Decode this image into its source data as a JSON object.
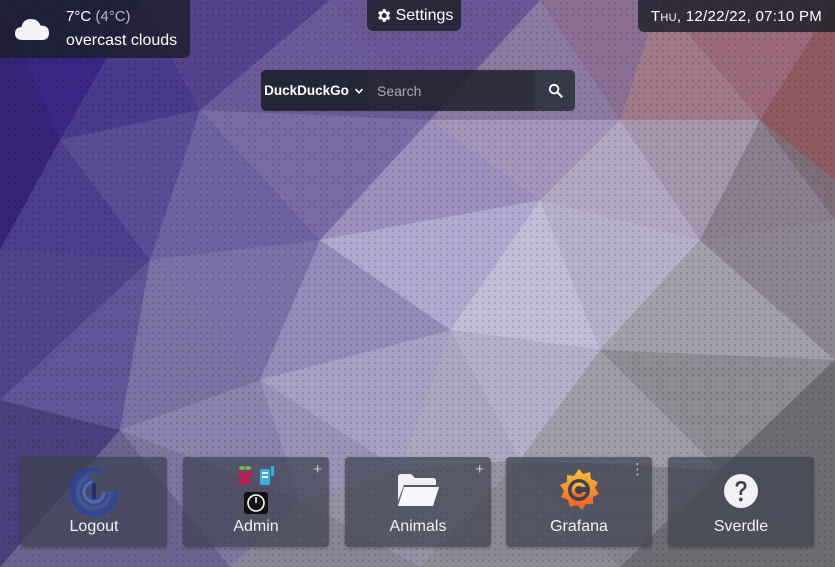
{
  "weather": {
    "temp": "7°C",
    "feels_like": "(4°C)",
    "description": "overcast clouds",
    "icon": "cloud-icon"
  },
  "settings": {
    "label": "Settings",
    "icon": "gear-icon"
  },
  "datetime": {
    "day": "Thu",
    "rest": ", 12/22/22, 07:10 PM"
  },
  "search": {
    "engine": "DuckDuckGo",
    "placeholder": "Search",
    "button_icon": "search-icon"
  },
  "tiles": [
    {
      "label": "Logout",
      "icon": "logout-ring-icon"
    },
    {
      "label": "Admin",
      "icon": "admin-apps-icon",
      "corner": "+"
    },
    {
      "label": "Animals",
      "icon": "folder-icon",
      "corner": "+"
    },
    {
      "label": "Grafana",
      "icon": "grafana-icon",
      "corner": "⋮"
    },
    {
      "label": "Sverdle",
      "icon": "question-icon"
    }
  ],
  "colors": {
    "panel": "#1c1e28",
    "tile": "#3e4250",
    "grafana_orange": "#f47a20",
    "raspberry_red": "#c51a4a",
    "raspberry_green": "#6cc04a",
    "logout_blue": "#2d48a8"
  }
}
